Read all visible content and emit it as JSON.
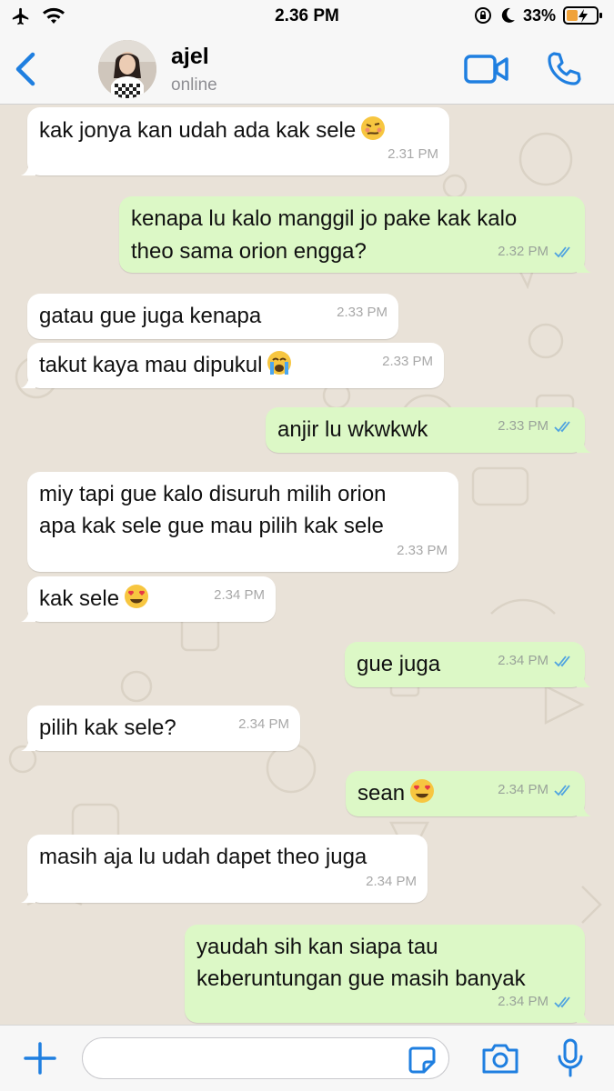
{
  "status_bar": {
    "time": "2.36 PM",
    "battery_percent": "33%",
    "icons": [
      "airplane-icon",
      "wifi-icon",
      "orientation-lock-icon",
      "moon-icon",
      "battery-charging-icon"
    ]
  },
  "header": {
    "contact_name": "ajel",
    "contact_status": "online",
    "icons": [
      "back-chevron-icon",
      "video-call-icon",
      "phone-call-icon"
    ]
  },
  "messages": [
    {
      "dir": "in",
      "text": "kak jonya kan udah ada kak sele",
      "emoji": "woozy-face-emoji",
      "time": "2.31 PM"
    },
    {
      "dir": "out",
      "text": "kenapa lu kalo manggil jo pake kak kalo",
      "text2": "theo sama orion engga?",
      "time": "2.32 PM",
      "status": "read"
    },
    {
      "dir": "in",
      "text": "gatau gue juga kenapa",
      "time": "2.33 PM"
    },
    {
      "dir": "in",
      "text": "takut kaya mau dipukul",
      "emoji": "crying-face-emoji",
      "time": "2.33 PM"
    },
    {
      "dir": "out",
      "text": "anjir lu wkwkwk",
      "time": "2.33 PM",
      "status": "read"
    },
    {
      "dir": "in",
      "text": "miy tapi gue kalo disuruh milih orion",
      "text2": "apa kak sele gue mau pilih kak sele",
      "time": "2.33 PM"
    },
    {
      "dir": "in",
      "text": "kak sele",
      "emoji": "heart-eyes-emoji",
      "time": "2.34 PM"
    },
    {
      "dir": "out",
      "text": "gue juga",
      "time": "2.34 PM",
      "status": "read"
    },
    {
      "dir": "in",
      "text": "pilih kak sele?",
      "time": "2.34 PM"
    },
    {
      "dir": "out",
      "text": "sean",
      "emoji": "heart-eyes-emoji",
      "time": "2.34 PM",
      "status": "read"
    },
    {
      "dir": "in",
      "text": "masih aja lu udah dapet theo juga",
      "time": "2.34 PM"
    },
    {
      "dir": "out",
      "text": "yaudah sih kan siapa tau",
      "text2": "keberuntungan gue masih banyak",
      "time": "2.34 PM",
      "status": "read"
    }
  ],
  "input_bar": {
    "message_value": "",
    "icons": [
      "plus-icon",
      "sticker-icon",
      "camera-icon",
      "microphone-icon"
    ]
  },
  "colors": {
    "accent": "#1f7fe0",
    "incoming_bubble": "#ffffff",
    "outgoing_bubble": "#dcf8c6",
    "read_tick": "#4fa3e0",
    "wallpaper": "#e9e2d8"
  }
}
